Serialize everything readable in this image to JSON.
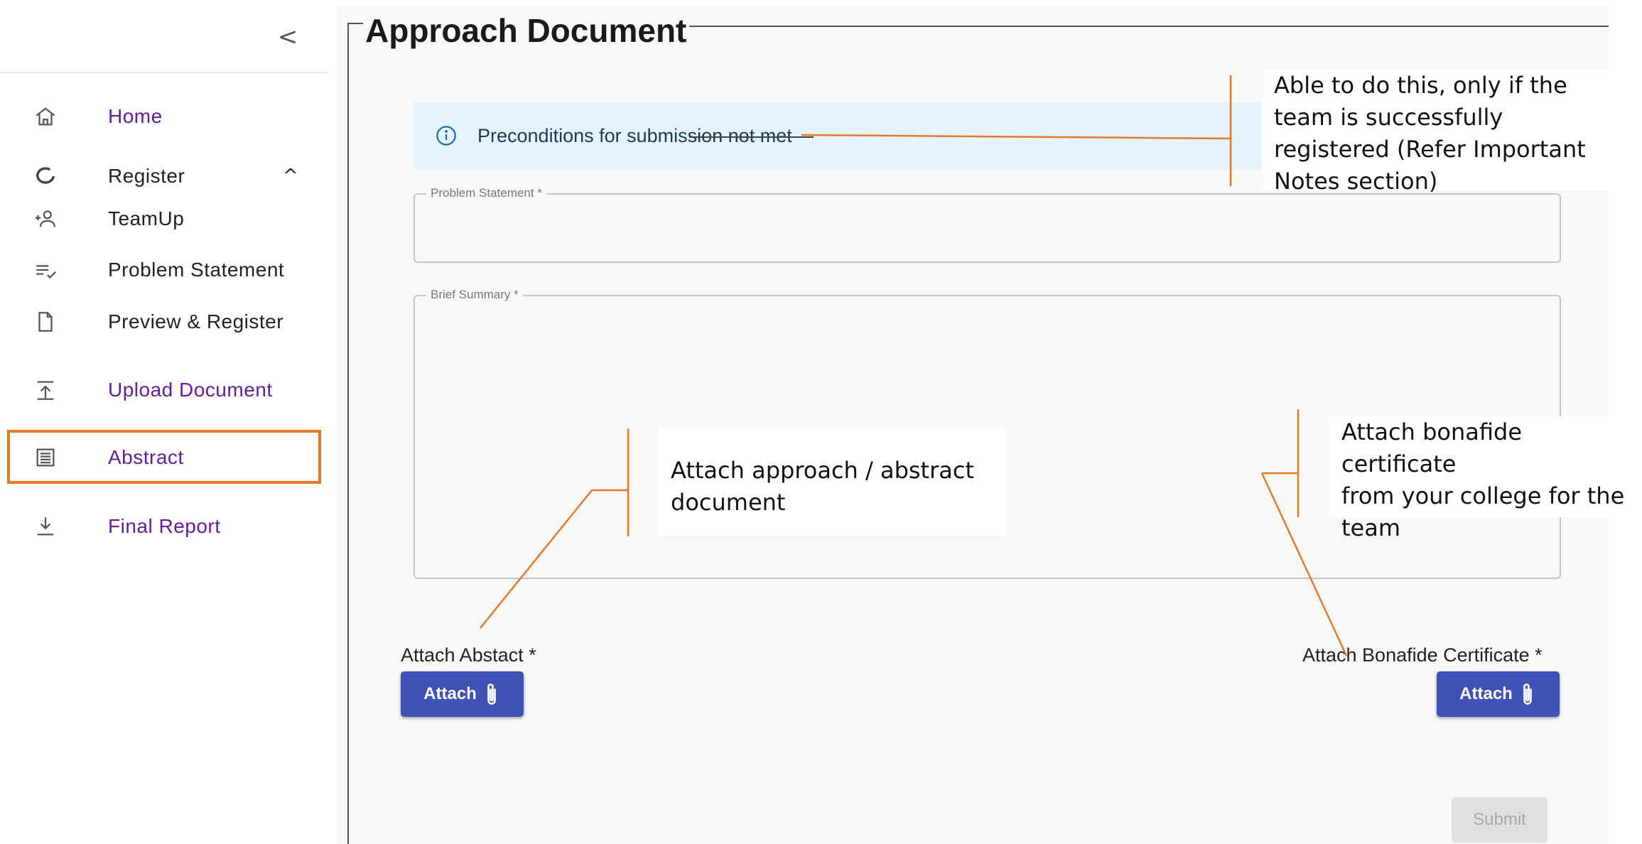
{
  "sidebar": {
    "collapse_glyph": "<",
    "items": [
      {
        "label": "Home",
        "icon": "home-icon"
      },
      {
        "label": "Register",
        "icon": "circle-outline-icon",
        "caret": "^"
      },
      {
        "label": "TeamUp",
        "icon": "add-person-icon"
      },
      {
        "label": "Problem Statement",
        "icon": "list-check-icon"
      },
      {
        "label": "Preview & Register",
        "icon": "file-icon"
      },
      {
        "label": "Upload Document",
        "icon": "upload-icon"
      },
      {
        "label": "Abstract",
        "icon": "article-icon"
      },
      {
        "label": "Final Report",
        "icon": "download-icon"
      }
    ],
    "highlighted": "Abstract"
  },
  "main": {
    "title": "Approach Document",
    "alert": {
      "text": "Preconditions for submission not met",
      "icon": "info-icon"
    },
    "problem_statement_label": "Problem Statement *",
    "brief_summary_label": "Brief Summary *",
    "attach_abstract_label": "Attach Abstact *",
    "attach_bonafide_label": "Attach Bonafide Certificate *",
    "attach_button_label": "Attach",
    "submit_label": "Submit"
  },
  "annotations": {
    "registration_note": "Able to do this, only if the\nteam is successfully\nregistered (Refer Important\nNotes section)",
    "abstract_note": "Attach approach / abstract\ndocument",
    "bonafide_note": "Attach bonafide certificate\nfrom your college for the\nteam"
  },
  "colors": {
    "accent": "#3f51b5",
    "nav_purple": "#6a1b9a",
    "highlight_orange": "#e57a2b",
    "alert_bg": "#e5f3fc"
  }
}
